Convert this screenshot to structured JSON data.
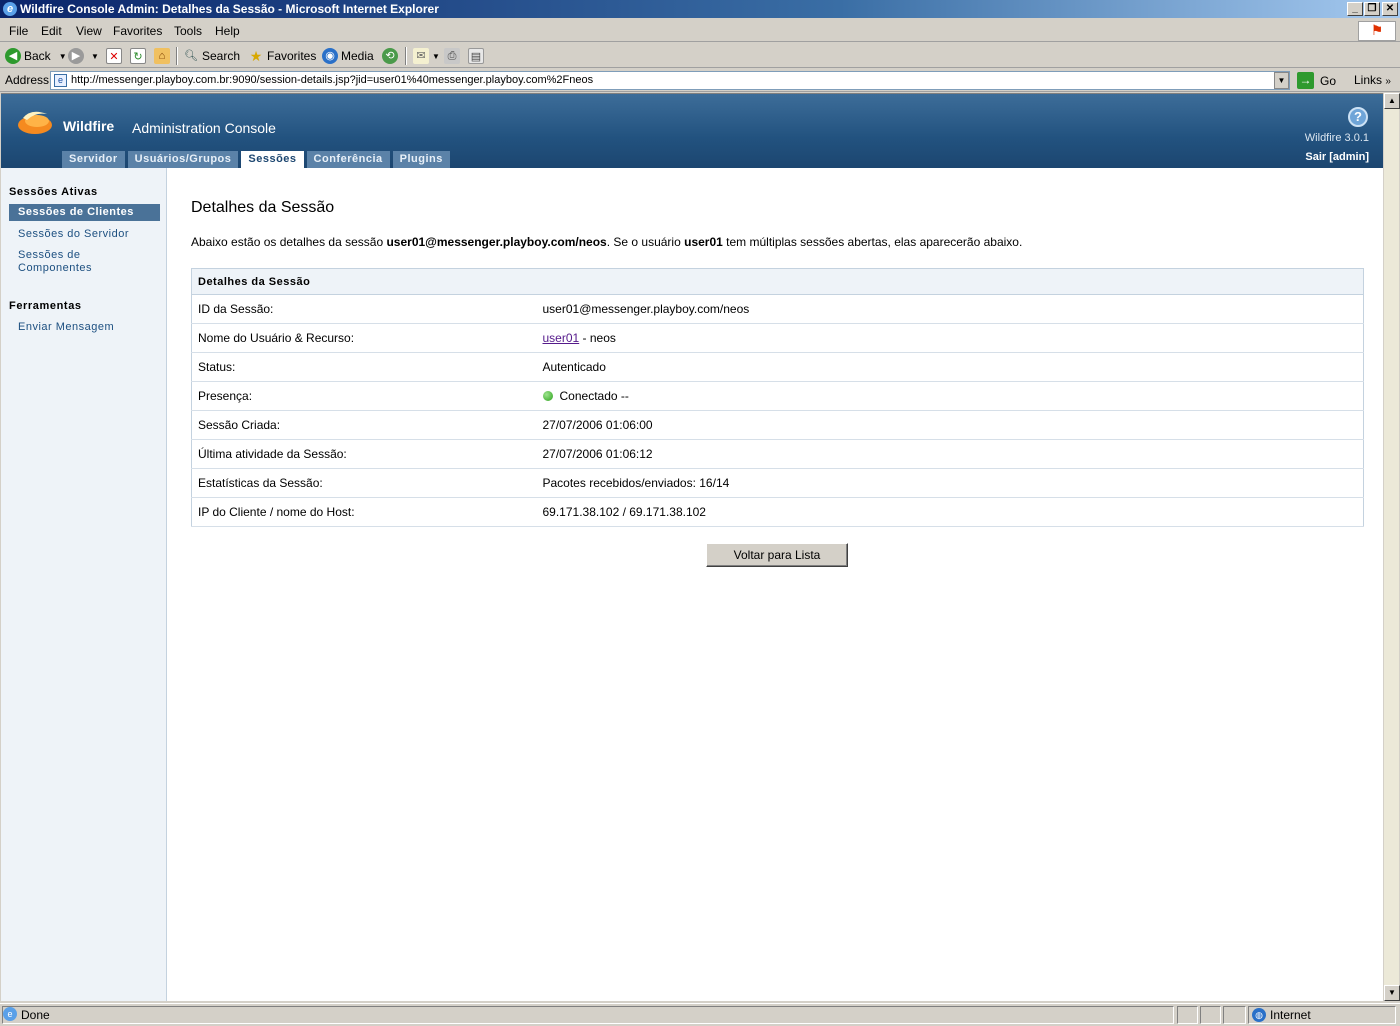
{
  "window": {
    "title": "Wildfire Console Admin: Detalhes da Sessão - Microsoft Internet Explorer"
  },
  "menu": [
    "File",
    "Edit",
    "View",
    "Favorites",
    "Tools",
    "Help"
  ],
  "toolbar": {
    "back": "Back",
    "search": "Search",
    "favorites": "Favorites",
    "media": "Media"
  },
  "address": {
    "label": "Address",
    "url": "http://messenger.playboy.com.br:9090/session-details.jsp?jid=user01%40messenger.playboy.com%2Fneos",
    "go": "Go",
    "links": "Links"
  },
  "header": {
    "brand": "Wildfire",
    "console": "Administration Console",
    "version": "Wildfire 3.0.1",
    "logout": "Sair [admin]",
    "help": "?"
  },
  "tabs": [
    {
      "label": "Servidor"
    },
    {
      "label": "Usuários/Grupos"
    },
    {
      "label": "Sessões"
    },
    {
      "label": "Conferência"
    },
    {
      "label": "Plugins"
    }
  ],
  "sidebar": {
    "section1": "Sessões Ativas",
    "items": [
      "Sessões de Clientes",
      "Sessões do Servidor",
      "Sessões de Componentes"
    ],
    "section2": "Ferramentas",
    "tools": [
      "Enviar Mensagem"
    ]
  },
  "page": {
    "title": "Detalhes da Sessão",
    "intro_pre": "Abaixo estão os detalhes da sessão ",
    "intro_jid": "user01@messenger.playboy.com/neos",
    "intro_mid": ". Se o usuário ",
    "intro_user": "user01",
    "intro_post": " tem múltiplas sessões abertas, elas aparecerão abaixo.",
    "table_header": "Detalhes da Sessão",
    "rows": [
      {
        "label": "ID da Sessão:",
        "value": "user01@messenger.playboy.com/neos"
      },
      {
        "label": "Nome do Usuário & Recurso:",
        "link": "user01",
        "value": " - neos"
      },
      {
        "label": "Status:",
        "value": "Autenticado"
      },
      {
        "label": "Presença:",
        "value": "Conectado --"
      },
      {
        "label": "Sessão Criada:",
        "value": "27/07/2006 01:06:00"
      },
      {
        "label": "Última atividade da Sessão:",
        "value": "27/07/2006 01:06:12"
      },
      {
        "label": "Estatísticas da Sessão:",
        "value": "Pacotes recebidos/enviados: 16/14"
      },
      {
        "label": "IP do Cliente / nome do Host:",
        "value": "69.171.38.102 / 69.171.38.102"
      }
    ],
    "back_button": "Voltar para Lista"
  },
  "status": {
    "text": "Done",
    "zone": "Internet"
  },
  "colors": {
    "header": "#22527f",
    "tab": "#5b82a8",
    "sidebar_bg": "#eef3f8",
    "active_item": "#4a7298",
    "presence": "#2aa01a"
  }
}
